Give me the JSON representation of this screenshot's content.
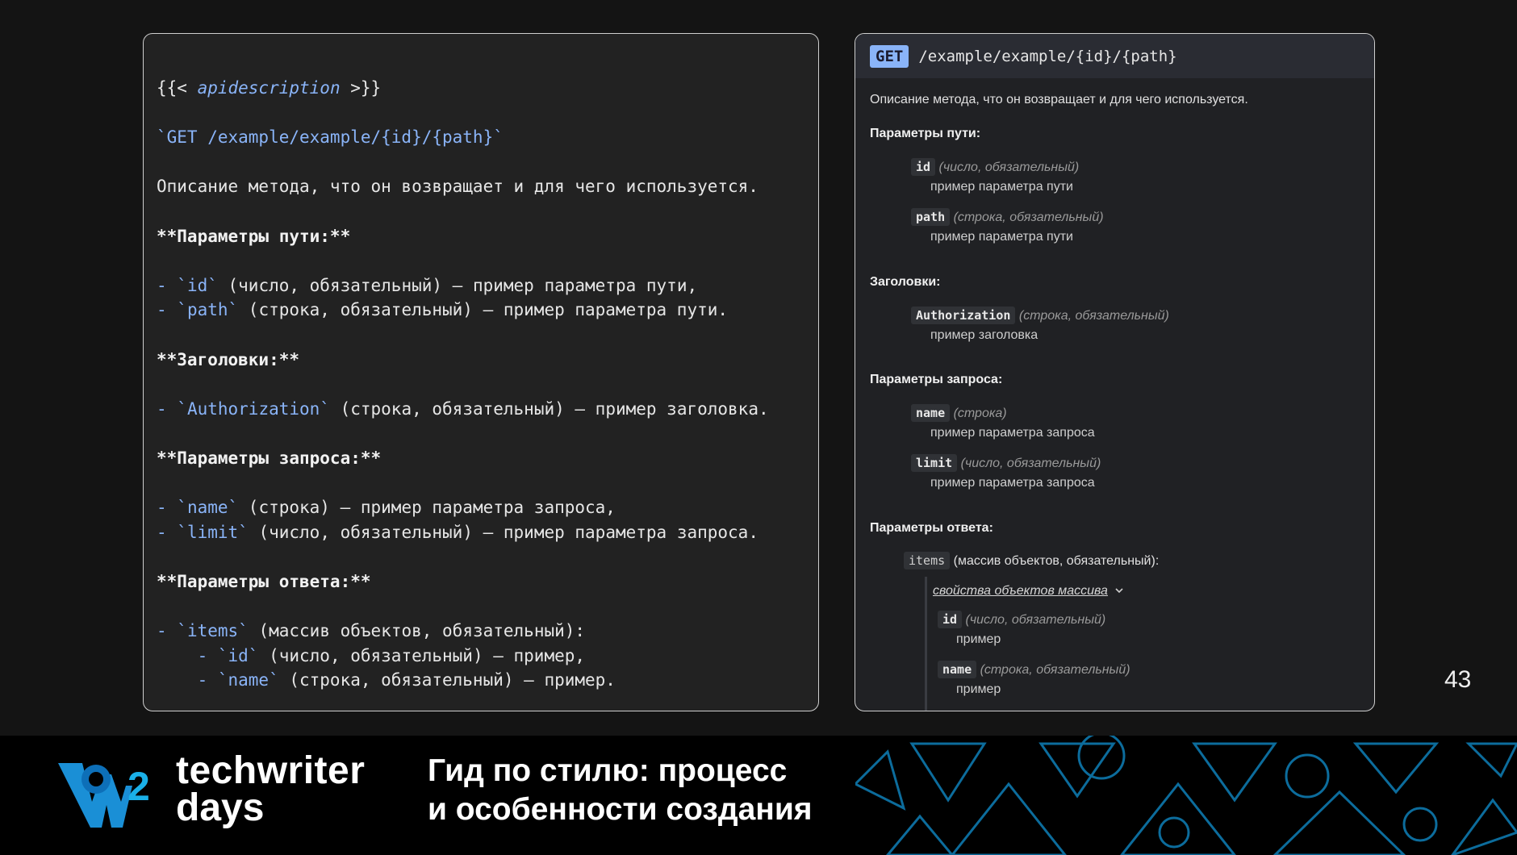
{
  "markdown_panel": {
    "lines": {
      "l1": {
        "open": "{{< ",
        "name": "apidescription",
        "close": " >}}"
      },
      "l2": "`GET /example/example/{id}/{path}`",
      "l3": "Описание метода, что он возвращает и для чего используется.",
      "l4": "**Параметры пути:**",
      "l5": {
        "bullet": "- ",
        "code": "`id`",
        "rest": " (число, обязательный) — пример параметра пути,"
      },
      "l6": {
        "bullet": "- ",
        "code": "`path`",
        "rest": " (строка, обязательный) — пример параметра пути."
      },
      "l7": "**Заголовки:**",
      "l8": {
        "bullet": "- ",
        "code": "`Authorization`",
        "rest": " (строка, обязательный) — пример заголовка."
      },
      "l9": "**Параметры запроса:**",
      "l10": {
        "bullet": "- ",
        "code": "`name`",
        "rest": " (строка) — пример параметра запроса,"
      },
      "l11": {
        "bullet": "- ",
        "code": "`limit`",
        "rest": " (число, обязательный) — пример параметра запроса."
      },
      "l12": "**Параметры ответа:**",
      "l13": {
        "bullet": "- ",
        "code": "`items`",
        "rest": " (массив объектов, обязательный):"
      },
      "l14": {
        "bullet": "    - ",
        "code": "`id`",
        "rest": " (число, обязательный) — пример,"
      },
      "l15": {
        "bullet": "    - ",
        "code": "`name`",
        "rest": " (строка, обязательный) — пример."
      }
    }
  },
  "doc_panel": {
    "method": "GET",
    "endpoint": "/example/example/{id}/{path}",
    "description": "Описание метода, что он возвращает и для чего используется.",
    "path_params": {
      "heading": "Параметры пути:",
      "p1": {
        "name": "id",
        "meta": "(число, обязательный)",
        "note": "пример параметра пути"
      },
      "p2": {
        "name": "path",
        "meta": "(строка, обязательный)",
        "note": "пример параметра пути"
      }
    },
    "headers": {
      "heading": "Заголовки:",
      "p1": {
        "name": "Authorization",
        "meta": "(строка, обязательный)",
        "note": "пример заголовка"
      }
    },
    "query_params": {
      "heading": "Параметры запроса:",
      "p1": {
        "name": "name",
        "meta": "(строка)",
        "note": "пример параметра запроса"
      },
      "p2": {
        "name": "limit",
        "meta": "(число, обязательный)",
        "note": "пример параметра запроса"
      }
    },
    "response_params": {
      "heading": "Параметры ответа:",
      "items": {
        "name": "items",
        "meta": "(массив объектов, обязательный):"
      },
      "toggle": "свойства объектов массива",
      "f1": {
        "name": "id",
        "meta": "(число, обязательный)",
        "note": "пример"
      },
      "f2": {
        "name": "name",
        "meta": "(строка, обязательный)",
        "note": "пример"
      }
    }
  },
  "slide_number": "43",
  "footer": {
    "brand_line1": "techwriter",
    "brand_line2": "days",
    "logo_number": "2",
    "title_line1": "Гид по стилю: процесс",
    "title_line2": "и особенности создания",
    "accent_color": "#1ab0e8"
  }
}
